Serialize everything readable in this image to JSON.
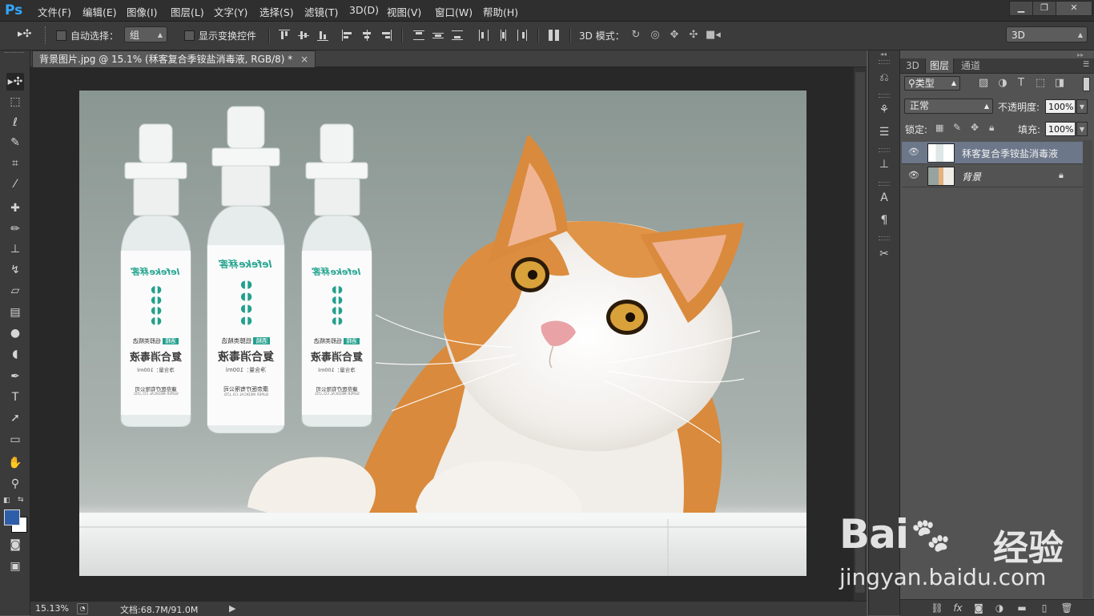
{
  "app": {
    "logo": "Ps"
  },
  "menu": [
    "文件(F)",
    "编辑(E)",
    "图像(I)",
    "图层(L)",
    "文字(Y)",
    "选择(S)",
    "滤镜(T)",
    "3D(D)",
    "视图(V)",
    "窗口(W)",
    "帮助(H)"
  ],
  "window_controls": {
    "minimize": "▁",
    "restore": "❐",
    "close": "✕"
  },
  "options": {
    "auto_select_label": "自动选择：",
    "auto_select_value": "组",
    "show_transform_label": "显示变换控件",
    "mode3d_label": "3D 模式：",
    "workspace_value": "3D"
  },
  "document": {
    "tab_title": "背景图片.jpg @ 15.1% (秝客复合季铵盐消毒液, RGB/8) *",
    "tab_close": "×"
  },
  "status": {
    "zoom": "15.13%",
    "doc_size": "文档:68.7M/91.0M"
  },
  "panel": {
    "tabs": [
      "3D",
      "图层",
      "通道"
    ],
    "active_tab": "图层",
    "filter_kind": "类型",
    "blend_mode": "正常",
    "opacity_label": "不透明度:",
    "opacity_value": "100%",
    "lock_label": "锁定:",
    "fill_label": "填充:",
    "fill_value": "100%",
    "layers": [
      {
        "name": "秝客复合季铵盐消毒液",
        "selected": true,
        "visible": true,
        "locked": false
      },
      {
        "name": "背景",
        "selected": false,
        "visible": true,
        "locked": true
      }
    ]
  },
  "product": {
    "brand": "lefeke秝客",
    "badge": "酒精",
    "tagline": "低醇类精选",
    "name": "复合消毒液",
    "volume": "净含量：100ml",
    "maker": "康奈医疗有限公司",
    "maker_en": "SUPER MEDICAL CO.,LTD."
  },
  "watermark": {
    "brand": "Bai",
    "brand_cn": "经验",
    "url": "jingyan.baidu.com"
  },
  "colors": {
    "fg_color": "#2f5ea8",
    "bg_color": "#ffffff",
    "selected_layer": "#6c778a"
  }
}
